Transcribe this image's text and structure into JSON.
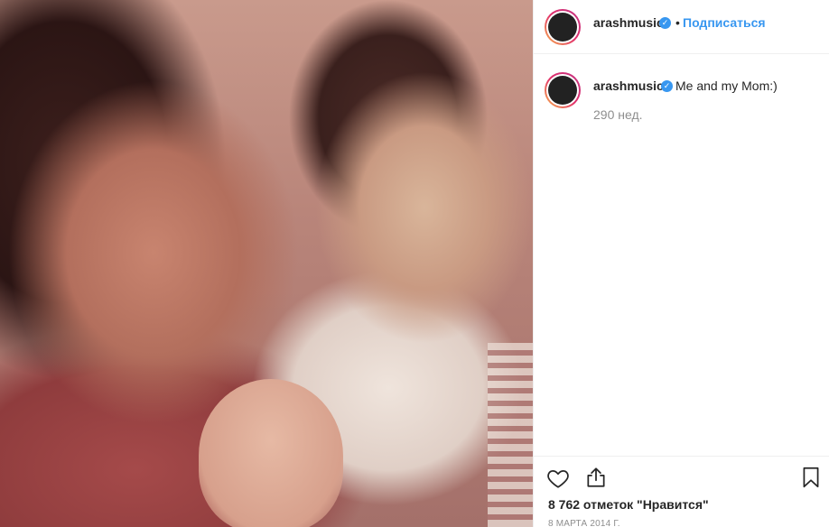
{
  "post": {
    "image_alt": "",
    "username": "arashmusic",
    "verified_mark": "✓",
    "separator": "•",
    "follow_label": "Подписаться",
    "caption": "Me and my Mom:)",
    "time_ago": "290 нед.",
    "likes_text": "8 762 отметок \"Нравится\"",
    "date": "8 марта 2014 г."
  },
  "icons": {
    "like": "heart-icon",
    "share": "share-icon",
    "save": "bookmark-icon",
    "verified": "verified-badge-icon"
  },
  "colors": {
    "link_blue": "#3897f0",
    "text": "#262626",
    "muted": "#8e8e8e",
    "border": "#efefef"
  }
}
